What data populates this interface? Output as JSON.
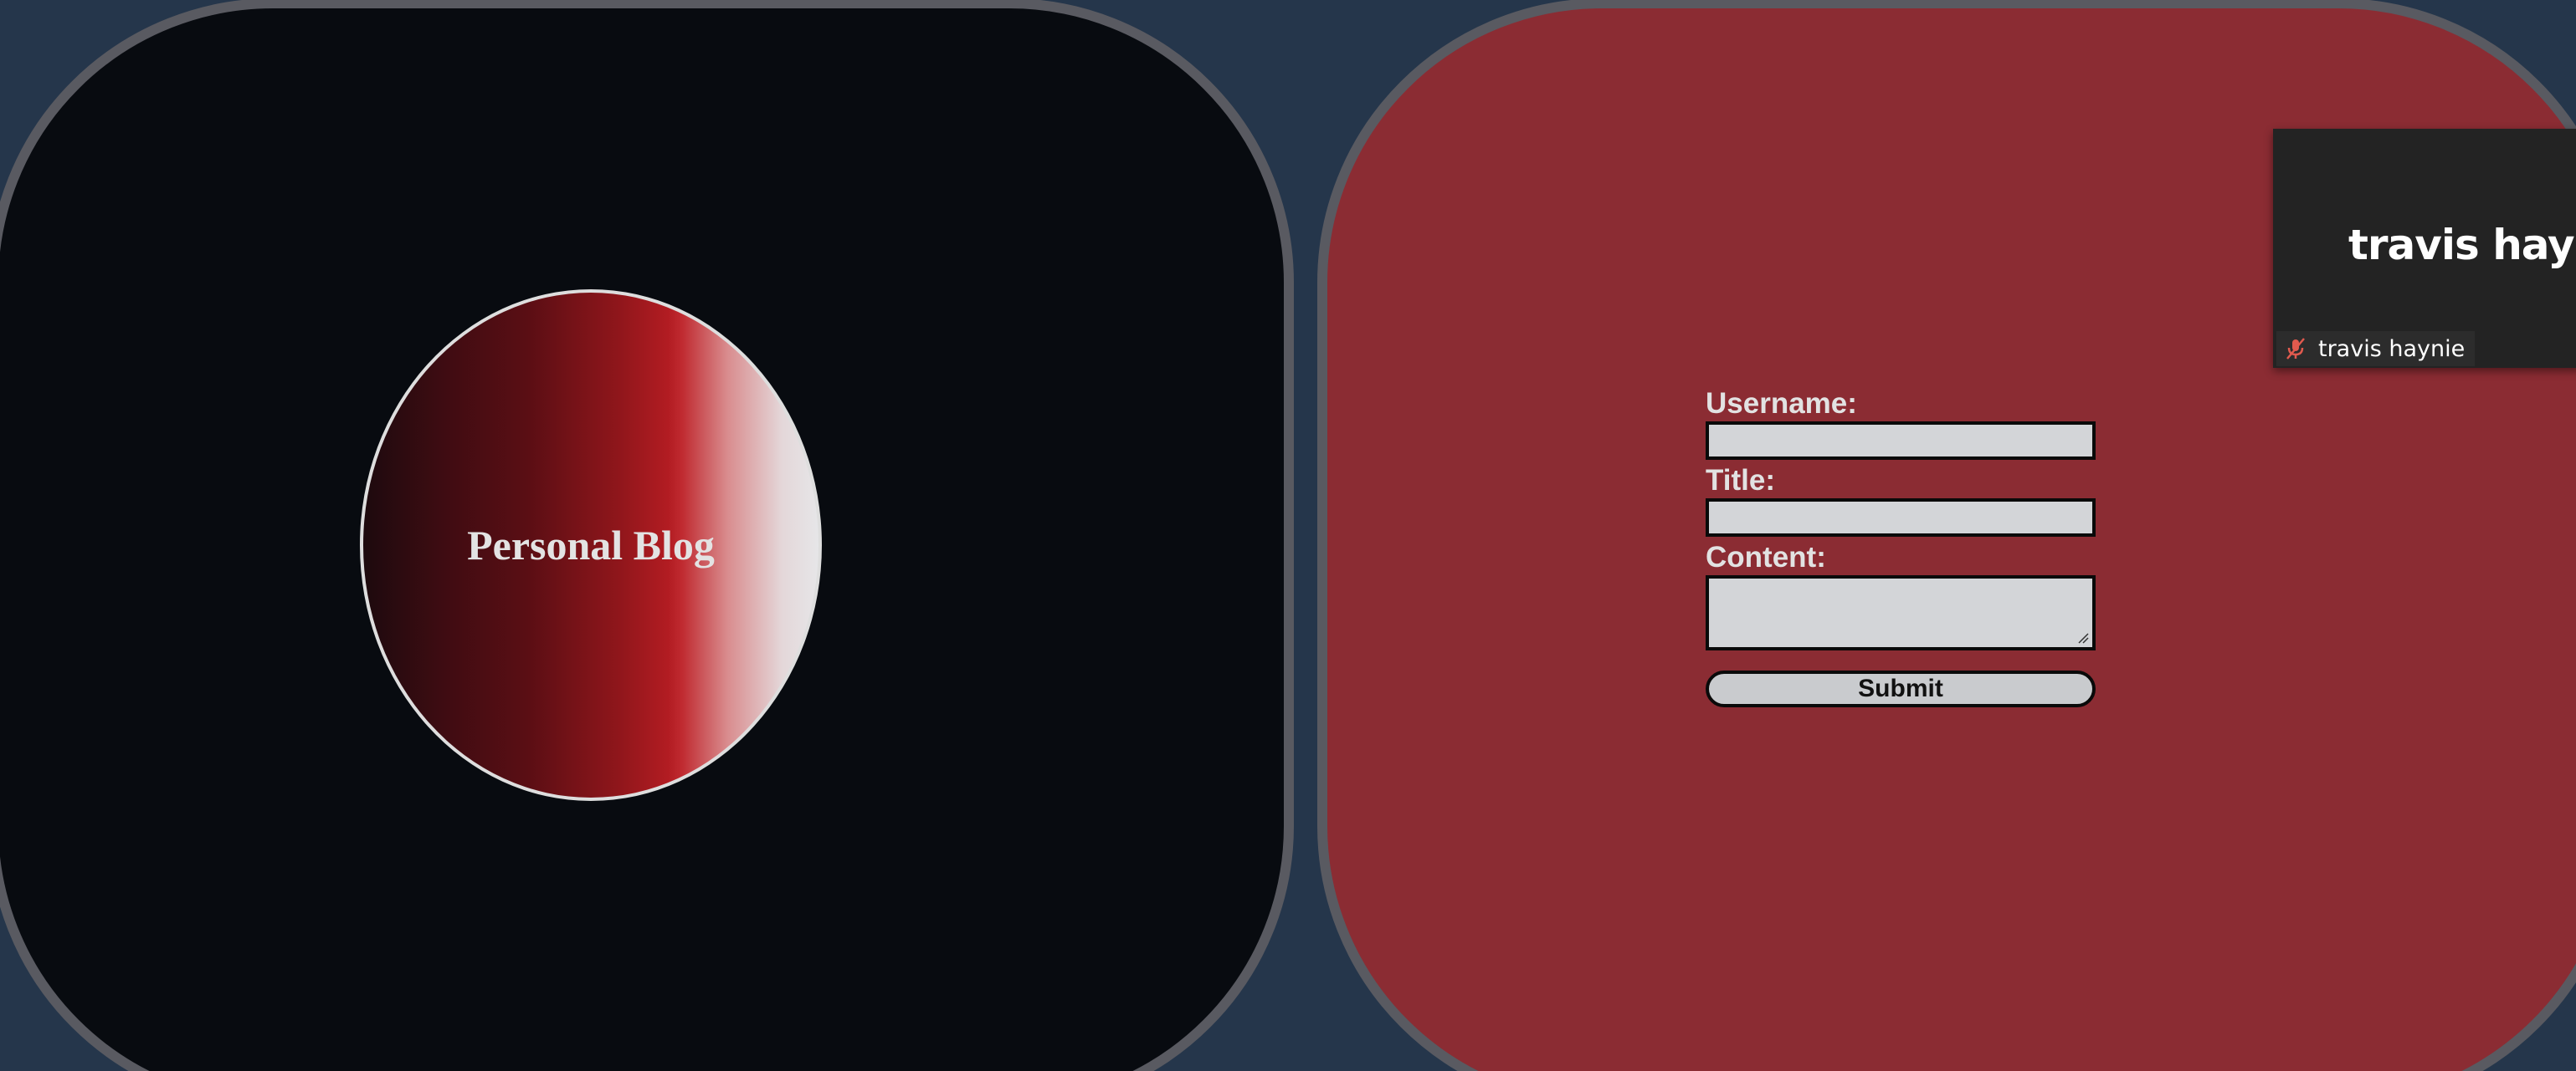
{
  "logo": {
    "title": "Personal Blog"
  },
  "form": {
    "username_label": "Username:",
    "username_value": "",
    "title_label": "Title:",
    "title_value": "",
    "content_label": "Content:",
    "content_value": "",
    "submit_label": "Submit"
  },
  "call": {
    "participant_name": "travis haynie",
    "participant_display": "travis hayn",
    "mic_icon": "mic-muted-icon",
    "muted": true
  },
  "colors": {
    "background": "#25364b",
    "left_panel": "#080b10",
    "right_panel": "#8b2c33",
    "panel_border": "#595a61",
    "input_bg": "#d3d5d8",
    "accent_red": "#b21c22",
    "mic_muted": "#e05a4e"
  }
}
